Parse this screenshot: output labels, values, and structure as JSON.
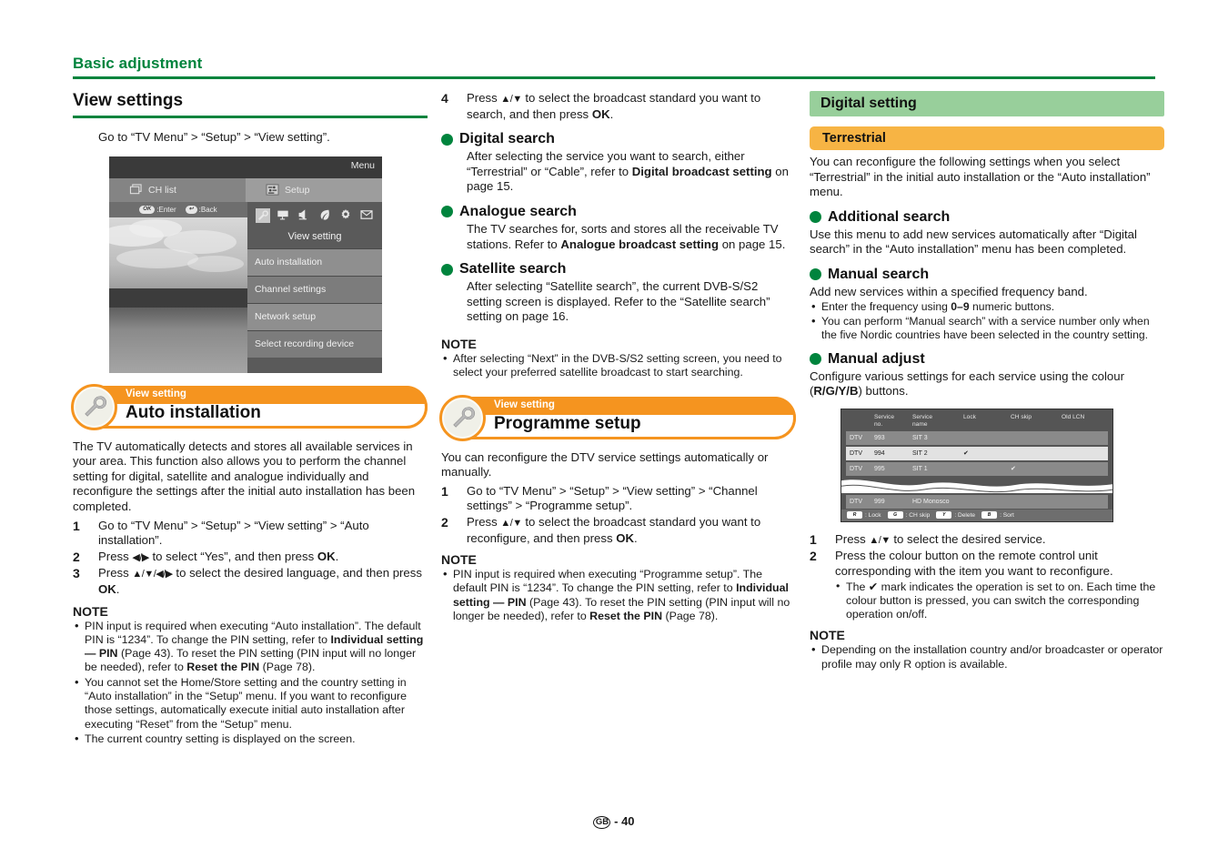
{
  "page": {
    "chapter_title": "Basic adjustment",
    "footer_region": "GB",
    "footer_separator": "-",
    "footer_page": "40"
  },
  "col1": {
    "section_title": "View settings",
    "intro": "Go to “TV Menu” > “Setup” > “View setting”.",
    "tv_menu": {
      "menu_label": "Menu",
      "tab_left": "CH list",
      "tab_right": "Setup",
      "hint_enter_key": "OK",
      "hint_enter": ":Enter",
      "hint_back_key": "↩",
      "hint_back": ":Back",
      "icons": [
        "wrench-icon",
        "picture-icon",
        "audio-icon",
        "eco-icon",
        "setup-icon",
        "mail-icon"
      ],
      "selected_label": "View setting",
      "items": [
        "Auto installation",
        "Channel settings",
        "Network setup",
        "Select recording device"
      ]
    },
    "banner": {
      "kicker": "View setting",
      "title": "Auto installation",
      "icon": "wrench-icon"
    },
    "paragraph": "The TV automatically detects and stores all available services in your area. This function also allows you to perform the channel setting for digital, satellite and analogue individually and reconfigure the settings after the initial auto installation has been completed.",
    "steps": [
      {
        "num": "1",
        "text": "Go to “TV Menu” > “Setup” > “View setting” > “Auto installation”."
      },
      {
        "num": "2",
        "text_pre": "Press ",
        "arrows": "◀/▶",
        "text_mid": " to select “Yes”, and then press ",
        "bold": "OK",
        "text_post": "."
      },
      {
        "num": "3",
        "text_pre": "Press ",
        "arrows": "▲/▼/◀/▶",
        "text_mid": " to select the desired language, and then press ",
        "bold": "OK",
        "text_post": "."
      }
    ],
    "note_heading": "NOTE",
    "notes": [
      "PIN input is required when executing “Auto installation”. The default PIN is “1234”. To change the PIN setting, refer to Individual setting — PIN (Page 43). To reset the PIN setting (PIN input will no longer be needed), refer to Reset the PIN (Page 78).",
      "You cannot set the Home/Store setting and the country setting in “Auto installation” in the “Setup” menu. If you want to reconfigure those settings, automatically execute initial auto installation after executing “Reset” from the “Setup” menu.",
      "The current country setting is displayed on the screen."
    ]
  },
  "col2": {
    "step4": {
      "num": "4",
      "text_pre": "Press ",
      "arrows": "▲/▼",
      "text_mid": " to select the broadcast standard you want to search, and then press ",
      "bold": "OK",
      "text_post": "."
    },
    "digital_search": {
      "heading": "Digital search",
      "body_pre": "After selecting the service you want to search, either “Terrestrial” or “Cable”, refer to ",
      "bold": "Digital broadcast setting",
      "body_post": " on page 15."
    },
    "analogue_search": {
      "heading": "Analogue search",
      "body_pre": "The TV searches for, sorts and stores all the receivable TV stations. Refer to ",
      "bold": "Analogue broadcast setting",
      "body_post": " on page 15."
    },
    "satellite_search": {
      "heading": "Satellite search",
      "body": "After selecting “Satellite search”, the current DVB-S/S2 setting screen is displayed. Refer to the “Satellite search” setting on page 16."
    },
    "note_heading": "NOTE",
    "notes": [
      "After selecting “Next” in the DVB-S/S2 setting screen, you need to select your preferred satellite broadcast to start searching."
    ],
    "banner": {
      "kicker": "View setting",
      "title": "Programme setup",
      "icon": "wrench-icon"
    },
    "paragraph": "You can reconfigure the DTV service settings automatically or manually.",
    "steps": [
      {
        "num": "1",
        "text": "Go to “TV Menu” > “Setup” > “View setting” > “Channel settings” > “Programme setup”."
      },
      {
        "num": "2",
        "text_pre": "Press ",
        "arrows": "▲/▼",
        "text_mid": " to select the broadcast standard you want to reconfigure, and then press ",
        "bold": "OK",
        "text_post": "."
      }
    ],
    "note_heading2": "NOTE",
    "notes2": [
      "PIN input is required when executing “Programme setup”. The default PIN is “1234”. To change the PIN setting, refer to Individual setting — PIN (Page 43). To reset the PIN setting (PIN input will no longer be needed), refer to Reset the PIN (Page 78)."
    ]
  },
  "col3": {
    "section_band": "Digital setting",
    "sub_band": "Terrestrial",
    "intro": "You can reconfigure the following settings when you select “Terrestrial” in the initial auto installation or the “Auto installation” menu.",
    "additional_search": {
      "heading": "Additional search",
      "body": "Use this menu to add new services automatically after “Digital search” in the “Auto installation” menu has been completed."
    },
    "manual_search": {
      "heading": "Manual search",
      "body": "Add new services within a specified frequency band.",
      "bullets_pre": [
        "Enter the frequency using ",
        "You can perform “Manual search” with a service number only when the five Nordic countries have been selected in the country setting."
      ],
      "bullet1_bold": "0–9",
      "bullet1_post": " numeric buttons."
    },
    "manual_adjust": {
      "heading": "Manual adjust",
      "body_pre": "Configure various settings for each service using the colour (",
      "bold": "R/G/Y/B",
      "body_post": ") buttons."
    },
    "service_table": {
      "headers": [
        "",
        "Service no.",
        "Service name",
        "Lock",
        "CH skip",
        "Old LCN"
      ],
      "rows": [
        {
          "type": "DTV",
          "no": "993",
          "name": "SIT 3",
          "lock": "",
          "chskip": "",
          "oldlcn": "",
          "style": "gray"
        },
        {
          "type": "DTV",
          "no": "994",
          "name": "SIT 2",
          "lock": "✔",
          "chskip": "",
          "oldlcn": "",
          "style": "light"
        },
        {
          "type": "DTV",
          "no": "995",
          "name": "SIT 1",
          "lock": "",
          "chskip": "✔",
          "oldlcn": "",
          "style": "gray"
        }
      ],
      "last_row": {
        "type": "DTV",
        "no": "999",
        "name": "HD Monosco",
        "style": "gray"
      },
      "legend": [
        {
          "key": "R",
          "label": ": Lock",
          "color": "#ffffff"
        },
        {
          "key": "G",
          "label": ": CH skip",
          "color": "#ffffff"
        },
        {
          "key": "Y",
          "label": ": Delete",
          "color": "#ffffff"
        },
        {
          "key": "B",
          "label": ": Sort",
          "color": "#ffffff"
        }
      ]
    },
    "steps": [
      {
        "num": "1",
        "text_pre": "Press ",
        "arrows": "▲/▼",
        "text_mid": " to select the desired service.",
        "bold": "",
        "text_post": ""
      },
      {
        "num": "2",
        "text": "Press the colour button on the remote control unit corresponding with the item you want to reconfigure."
      }
    ],
    "substep": "The ✔ mark indicates the operation is set to on. Each time the colour button is pressed, you can switch the corresponding operation on/off.",
    "note_heading": "NOTE",
    "notes": [
      "Depending on the installation country and/or broadcaster or operator profile may only R option is available."
    ]
  },
  "colors": {
    "green": "#00843d",
    "band_green": "#98cf9b",
    "band_orange": "#f7b444",
    "pill_orange": "#f5941f"
  }
}
